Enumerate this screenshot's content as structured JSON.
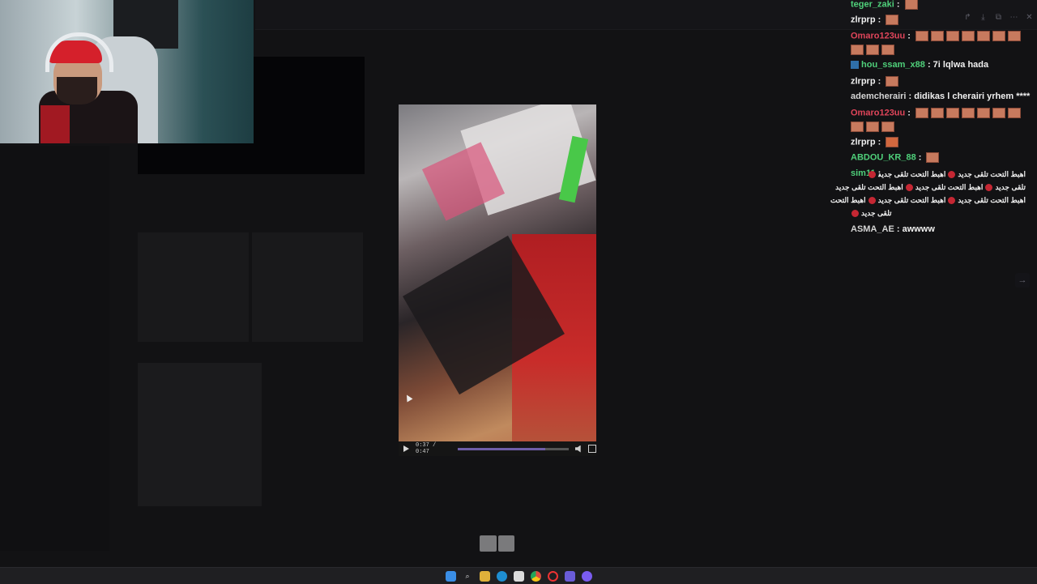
{
  "chat": {
    "messages": [
      {
        "user": "teger_zaki",
        "color": "#4fd07a",
        "text": "",
        "emotes": 1
      },
      {
        "user": "zlrprp",
        "color": "#f0f0f0",
        "text": "",
        "emotes": 1
      },
      {
        "user": "Omaro123uu",
        "color": "#e0455a",
        "text": "",
        "emotes": 10
      },
      {
        "user": "hou_ssam_x88",
        "color": "#4fd07a",
        "text": "7i lqlwa hada",
        "emotes": 0,
        "badge": true
      },
      {
        "user": "zlrprp",
        "color": "#f0f0f0",
        "text": "",
        "emotes": 1
      },
      {
        "user": "ademcherairi",
        "color": "#d5d5d5",
        "text": "didikas l cherairi yrhem ****",
        "emotes": 0
      },
      {
        "user": "Omaro123uu",
        "color": "#e0455a",
        "text": "",
        "emotes": 10
      },
      {
        "user": "zlrprp",
        "color": "#f0f0f0",
        "text": "",
        "emotes": 1
      },
      {
        "user": "ABDOU_KR_88",
        "color": "#4fd07a",
        "text": "",
        "emotes": 1
      },
      {
        "user": "sim11",
        "color": "#4fd07a",
        "text": "",
        "emotes": 0
      },
      {
        "user": "ASMA_AE",
        "color": "#d5d5d5",
        "text": "awwww",
        "emotes": 0
      }
    ],
    "sim11_lines": [
      "اهبط التحت تلقى جديد",
      "اهبط التحت تلقى جديد",
      "اهبط التحت تلقى جديد",
      "اهبط التحت تلقى جديد",
      "اهبط التحت تلقى جديد",
      "اهبط التحت تلقى جديد",
      "اهبط التحت",
      "تلقى جديد",
      "تلقى جديد"
    ]
  },
  "video": {
    "time": "0:37 / 0:47",
    "progress": 0.79
  },
  "taskbar": {
    "icons": [
      "windows-start-icon",
      "search-icon",
      "file-explorer-icon",
      "edge-icon",
      "store-icon",
      "chrome-icon",
      "opera-icon",
      "discord-icon",
      "messenger-icon"
    ]
  }
}
